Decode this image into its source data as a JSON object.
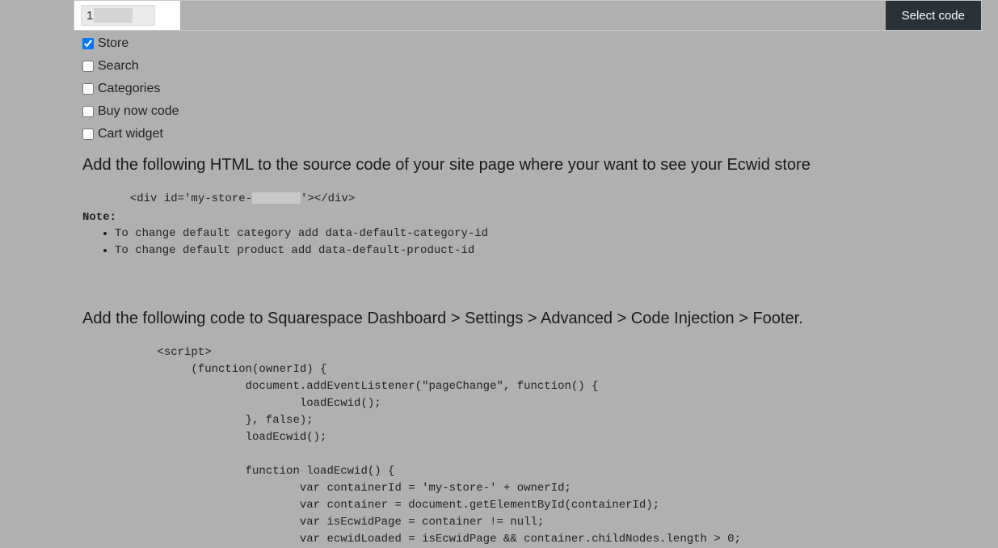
{
  "topbar": {
    "input_value": "1",
    "select_label": "Select code"
  },
  "checkboxes": [
    {
      "label": "Store",
      "checked": true
    },
    {
      "label": "Search",
      "checked": false
    },
    {
      "label": "Categories",
      "checked": false
    },
    {
      "label": "Buy now code",
      "checked": false
    },
    {
      "label": "Cart widget",
      "checked": false
    }
  ],
  "instruction1": "Add the following HTML to the source code of your site page where your want to see your Ecwid store",
  "snippet1_pre": "       <div id='my-store-",
  "snippet1_post": "'></div>",
  "note_label": "Note:",
  "notes": [
    "To change default category add data-default-category-id",
    "To change default product add data-default-product-id"
  ],
  "instruction2": "Add the following code to Squarespace Dashboard > Settings > Advanced > Code Injection > Footer.",
  "script_code": "           <script>\n                (function(ownerId) {\n                        document.addEventListener(\"pageChange\", function() {\n                                loadEcwid();\n                        }, false);\n                        loadEcwid();\n\n                        function loadEcwid() {\n                                var containerId = 'my-store-' + ownerId;\n                                var container = document.getElementById(containerId);\n                                var isEcwidPage = container != null;\n                                var ecwidLoaded = isEcwidPage && container.childNodes.length > 0;"
}
